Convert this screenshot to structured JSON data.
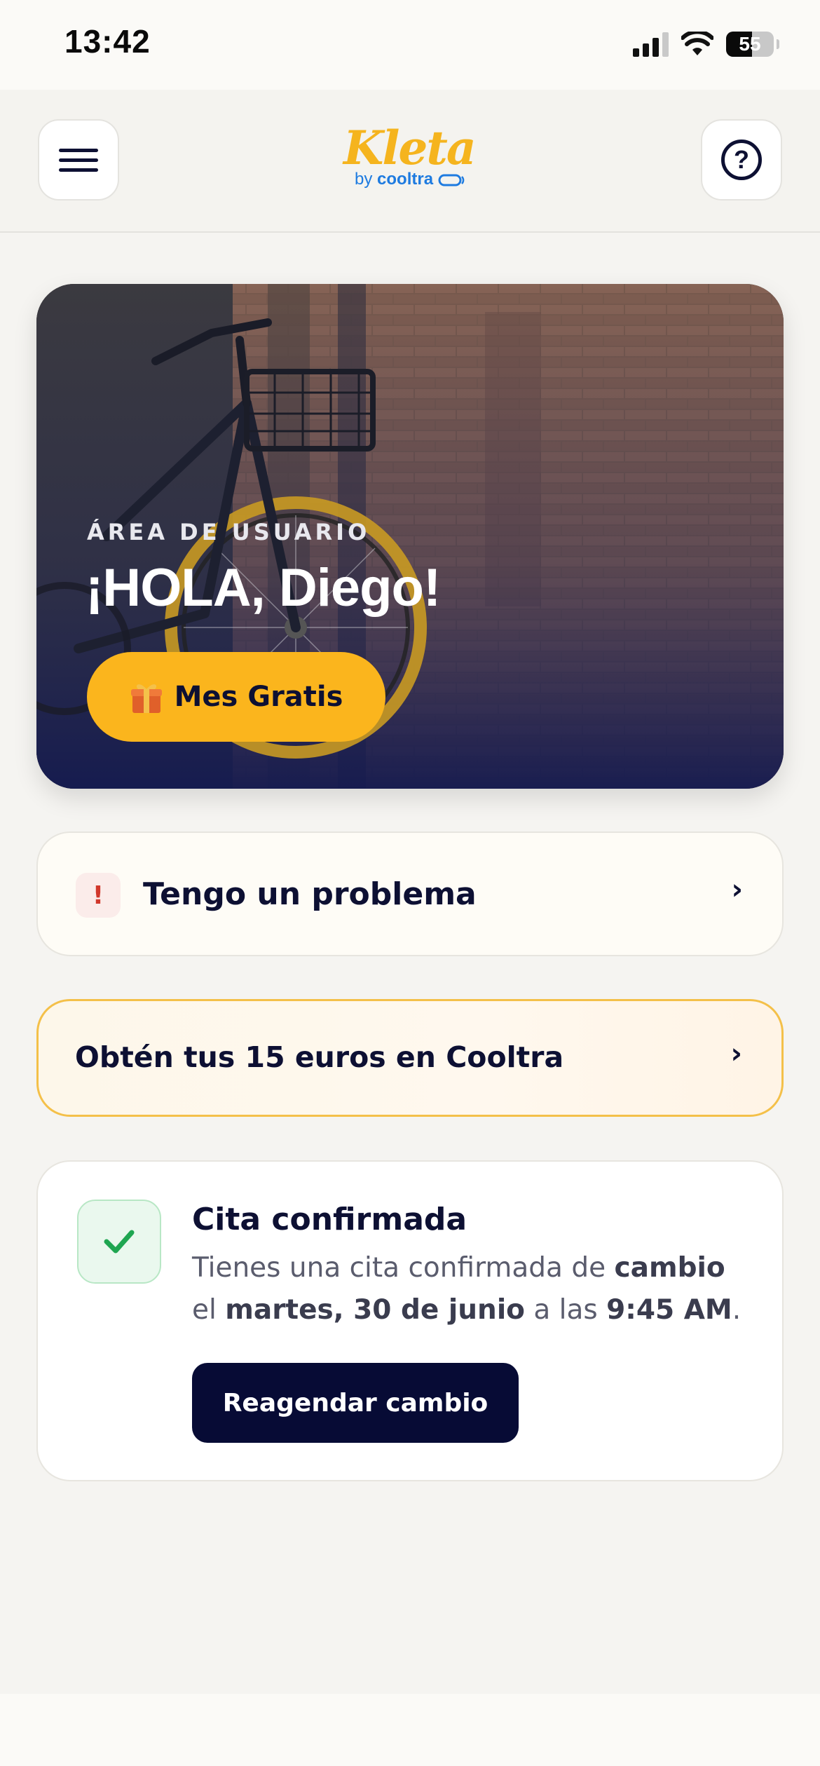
{
  "status_bar": {
    "time": "13:42",
    "battery_level": "55",
    "battery_fraction": 0.55
  },
  "header": {
    "logo_text": "Kleta",
    "logo_sub_prefix": "by",
    "logo_sub_brand": "cooltra",
    "menu_icon": "hamburger-menu-icon",
    "help_icon": "question-circle-icon"
  },
  "hero": {
    "eyebrow": "ÁREA DE USUARIO",
    "greeting": "¡HOLA, Diego!",
    "cta_label": "Mes Gratis",
    "cta_icon": "gift-icon"
  },
  "problem_card": {
    "badge": "!",
    "label": "Tengo un problema",
    "chevron": "›"
  },
  "promo_card": {
    "label": "Obtén tus 15 euros en Cooltra",
    "chevron": "›",
    "border_color": "#f4c049"
  },
  "appointment": {
    "icon": "check-icon",
    "title": "Cita confirmada",
    "desc_1": "Tienes una cita confirmada de ",
    "desc_type": "cambio",
    "desc_2": " el ",
    "desc_date": "martes, 30 de junio",
    "desc_3": " a las ",
    "desc_time": "9:45 AM",
    "desc_end": ".",
    "button_label": "Reagendar cambio"
  },
  "colors": {
    "accent": "#fbb51d",
    "navy": "#070b35",
    "success": "#1fa651",
    "danger": "#d1382c",
    "link_blue": "#1e7be0"
  }
}
